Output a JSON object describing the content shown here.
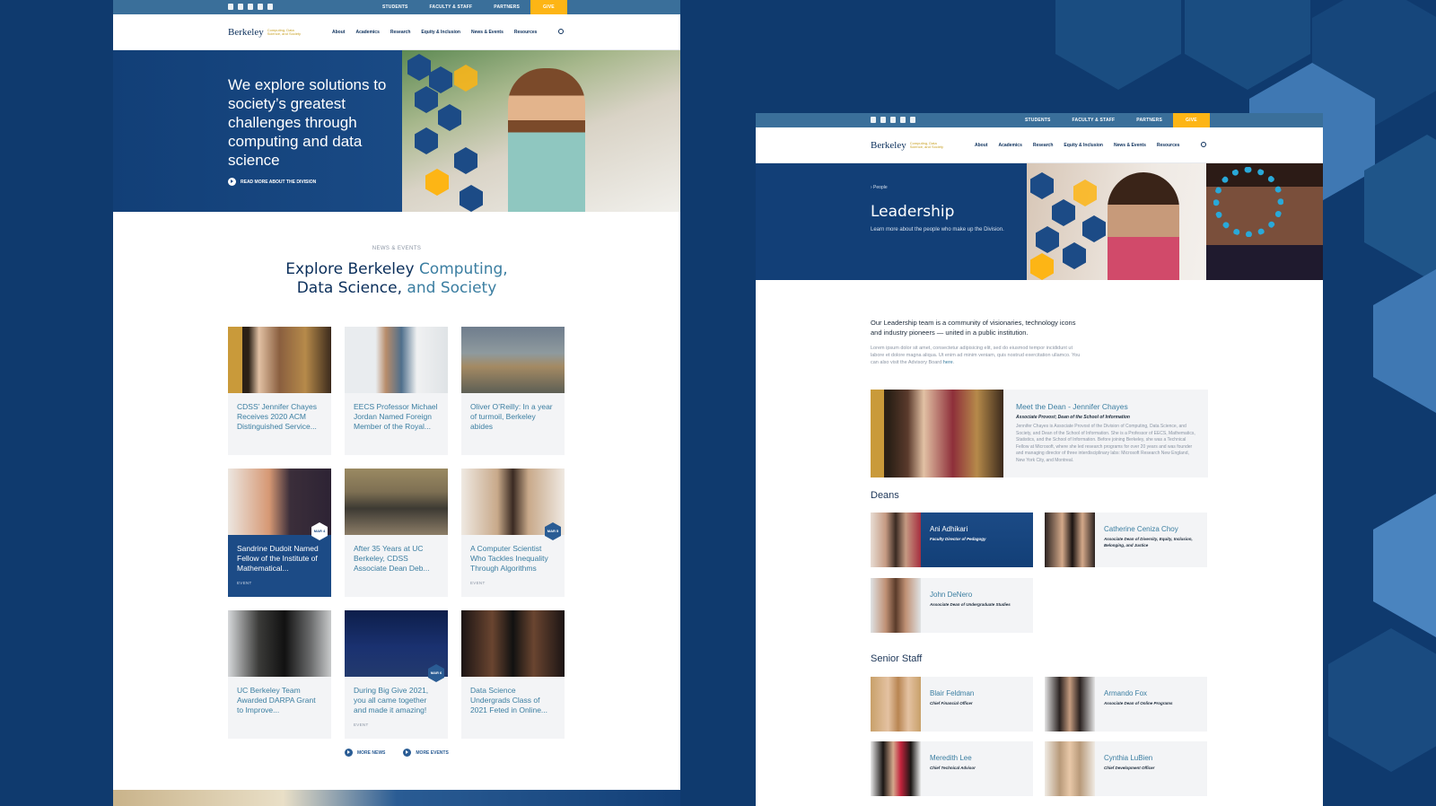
{
  "utility": {
    "students": "STUDENTS",
    "faculty_staff": "FACULTY & STAFF",
    "partners": "PARTNERS",
    "give": "GIVE"
  },
  "logo": {
    "wordmark": "Berkeley",
    "subtitle": "Computing, Data Science, and Society"
  },
  "nav": {
    "about": "About",
    "academics": "Academics",
    "research": "Research",
    "equity": "Equity & Inclusion",
    "news_events": "News & Events",
    "resources": "Resources"
  },
  "home": {
    "hero_title": "We explore solutions to society’s greatest challenges through computing and data science",
    "hero_link": "READ MORE ABOUT THE DIVISION",
    "eyebrow": "NEWS & EVENTS",
    "title_part1": "Explore Berkeley ",
    "title_part2": "Computing,",
    "title_part3": "Data Science,",
    "title_part4": " and ",
    "title_part5": "Society",
    "cards": [
      {
        "text": "CDSS’ Jennifer Chayes Receives 2020 ACM Distinguished Service...",
        "tag": "",
        "badge": ""
      },
      {
        "text": "EECS Professor Michael Jordan Named Foreign Member of the Royal...",
        "tag": "",
        "badge": ""
      },
      {
        "text": "Oliver O’Reilly: In a year of turmoil, Berkeley abides",
        "tag": "",
        "badge": ""
      },
      {
        "text": "Sandrine Dudoit Named Fellow of the Institute of Mathematical...",
        "tag": "EVENT",
        "badge": "MAR 4"
      },
      {
        "text": "After 35 Years at UC Berkeley, CDSS Associate Dean Deb...",
        "tag": "",
        "badge": ""
      },
      {
        "text": "A Computer Scientist Who Tackles Inequality Through Algorithms",
        "tag": "EVENT",
        "badge": "MAR 5"
      },
      {
        "text": "UC Berkeley Team Awarded DARPA Grant to Improve...",
        "tag": "",
        "badge": ""
      },
      {
        "text": "During Big Give 2021, you all came together and made it amazing!",
        "tag": "EVENT",
        "badge": "MAR 6"
      },
      {
        "text": "Data Science Undergrads Class of 2021 Feted in Online...",
        "tag": "",
        "badge": ""
      }
    ],
    "more_news": "MORE NEWS",
    "more_events": "MORE EVENTS"
  },
  "leadership": {
    "crumb": "› People",
    "title": "Leadership",
    "subtitle": "Learn more about the people who make up the Division.",
    "intro": "Our Leadership team is a community of visionaries, technology icons and industry pioneers — united in a public institution.",
    "lorem": "Lorem ipsum dolor sit amet, consectetur adipisicing elit, sed do eiusmod tempor incididunt ut labore et dolore magna aliqua. Ut enim ad minim veniam, quis nostrud exercitation ullamco. You can also visit the Advisory Board",
    "lorem_link": "here",
    "dean": {
      "name": "Meet the Dean - Jennifer Chayes",
      "title": "Associate Provost; Dean of the School of Information",
      "bio": "Jennifer Chayes is Associate Provost of the Division of Computing, Data Science, and Society, and Dean of the School of Information. She is a Professor of EECS, Mathematics, Statistics, and the School of Information. Before joining Berkeley, she was a Technical Fellow at Microsoft, where she led research programs for over 20 years and was founder and managing director of three interdisciplinary labs: Microsoft Research New England, New York City, and Montreal."
    },
    "deans_heading": "Deans",
    "deans": [
      {
        "name": "Ani Adhikari",
        "title": "Faculty Director of Pedagogy"
      },
      {
        "name": "Catherine Ceniza Choy",
        "title": "Associate Dean of Diversity, Equity, Inclusion, Belonging, and Justice"
      },
      {
        "name": "John DeNero",
        "title": "Associate Dean of Undergraduate Studies"
      }
    ],
    "staff_heading": "Senior Staff",
    "staff": [
      {
        "name": "Blair Feldman",
        "title": "Chief Financial Officer"
      },
      {
        "name": "Armando Fox",
        "title": "Associate Dean of Online Programs"
      },
      {
        "name": "Meredith Lee",
        "title": "Chief Technical Advisor"
      },
      {
        "name": "Cynthia LuBien",
        "title": "Chief Development Officer"
      }
    ]
  },
  "colors": {
    "navy": "#0f3a6e",
    "utility_blue": "#3a6f9a",
    "gold": "#fdb515",
    "link_blue": "#3b7ea1"
  }
}
